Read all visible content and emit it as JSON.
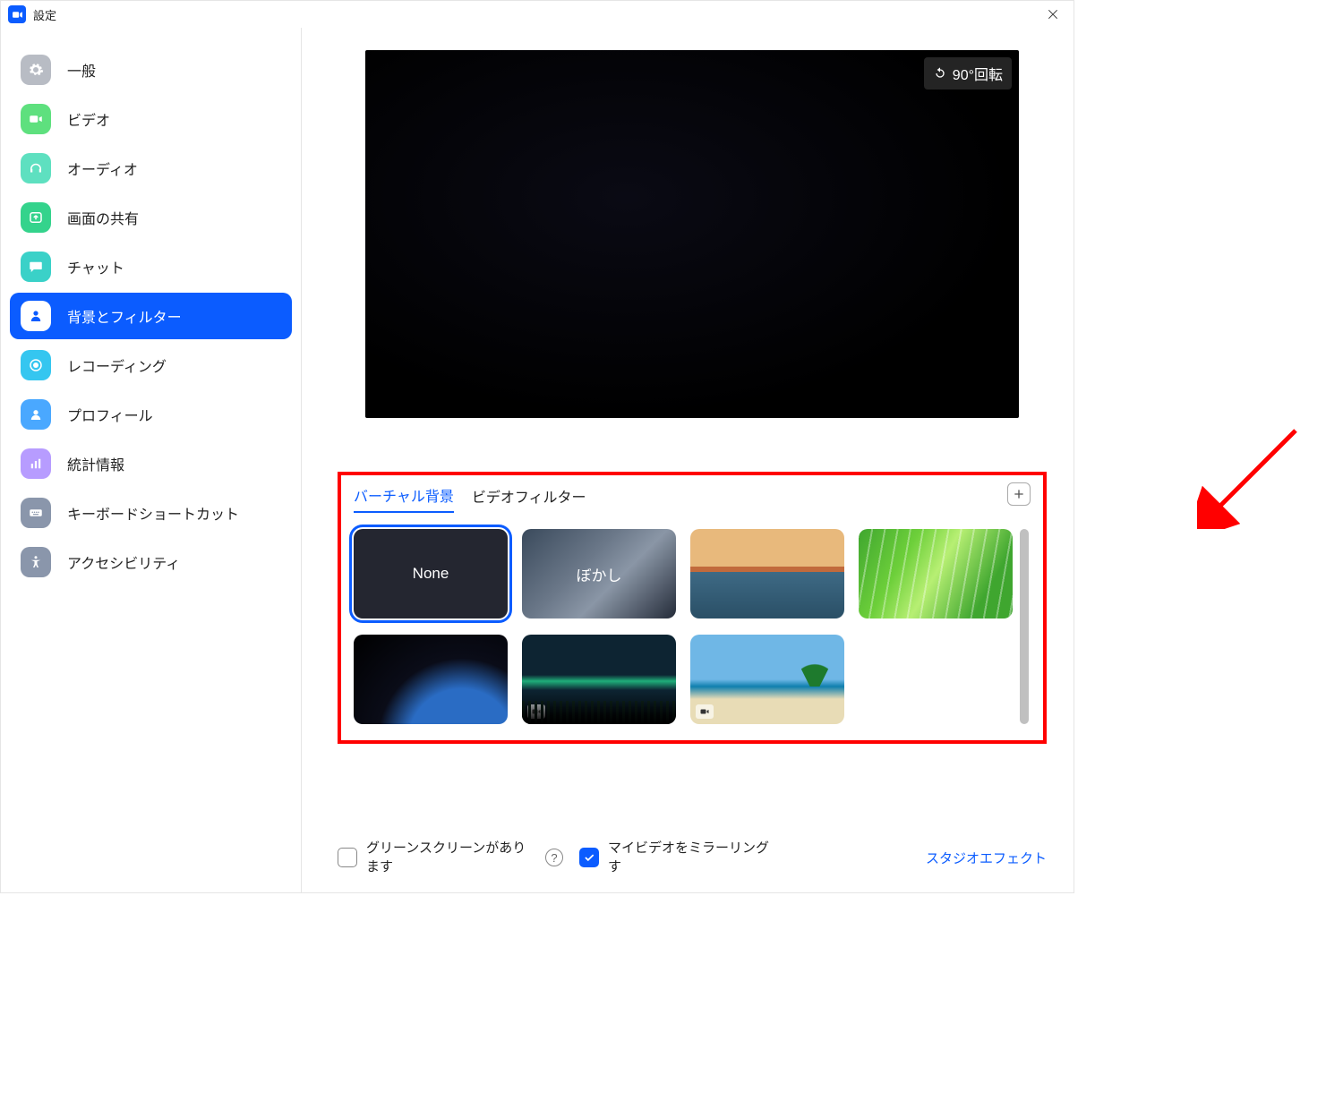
{
  "window": {
    "title": "設定"
  },
  "sidebar": {
    "items": [
      {
        "key": "general",
        "label": "一般",
        "icon": "gear",
        "color": "#b8bcc4"
      },
      {
        "key": "video",
        "label": "ビデオ",
        "icon": "video",
        "color": "#5ee07e"
      },
      {
        "key": "audio",
        "label": "オーディオ",
        "icon": "headset",
        "color": "#5ee0c0"
      },
      {
        "key": "share",
        "label": "画面の共有",
        "icon": "upload",
        "color": "#34d38c"
      },
      {
        "key": "chat",
        "label": "チャット",
        "icon": "chat",
        "color": "#3ad1c8"
      },
      {
        "key": "bg",
        "label": "背景とフィルター",
        "icon": "person",
        "color": "#ffffff",
        "active": true
      },
      {
        "key": "recording",
        "label": "レコーディング",
        "icon": "record",
        "color": "#35c6f0"
      },
      {
        "key": "profile",
        "label": "プロフィール",
        "icon": "avatar",
        "color": "#4aa8ff"
      },
      {
        "key": "stats",
        "label": "統計情報",
        "icon": "stats",
        "color": "#b79cff"
      },
      {
        "key": "keyboard",
        "label": "キーボードショートカット",
        "icon": "keyboard",
        "color": "#8a96ab"
      },
      {
        "key": "a11y",
        "label": "アクセシビリティ",
        "icon": "a11y",
        "color": "#8a96ab"
      }
    ]
  },
  "preview": {
    "rotate_label": "90°回転"
  },
  "bg_panel": {
    "tabs": [
      {
        "label": "バーチャル背景",
        "active": true
      },
      {
        "label": "ビデオフィルター",
        "active": false
      }
    ],
    "thumbs": [
      {
        "key": "none",
        "label": "None",
        "selected": true,
        "kind": "text"
      },
      {
        "key": "blur",
        "label": "ぼかし",
        "selected": false,
        "kind": "text"
      },
      {
        "key": "bridge",
        "label": "",
        "selected": false,
        "kind": "image"
      },
      {
        "key": "grass",
        "label": "",
        "selected": false,
        "kind": "image"
      },
      {
        "key": "earth",
        "label": "",
        "selected": false,
        "kind": "image"
      },
      {
        "key": "aurora",
        "label": "",
        "selected": false,
        "kind": "video"
      },
      {
        "key": "beach",
        "label": "",
        "selected": false,
        "kind": "video"
      }
    ]
  },
  "options": {
    "greenscreen_label": "グリーンスクリーンがあります",
    "greenscreen_checked": false,
    "mirror_label": "マイビデオをミラーリングす",
    "mirror_checked": true,
    "studio_label": "スタジオエフェクト"
  }
}
